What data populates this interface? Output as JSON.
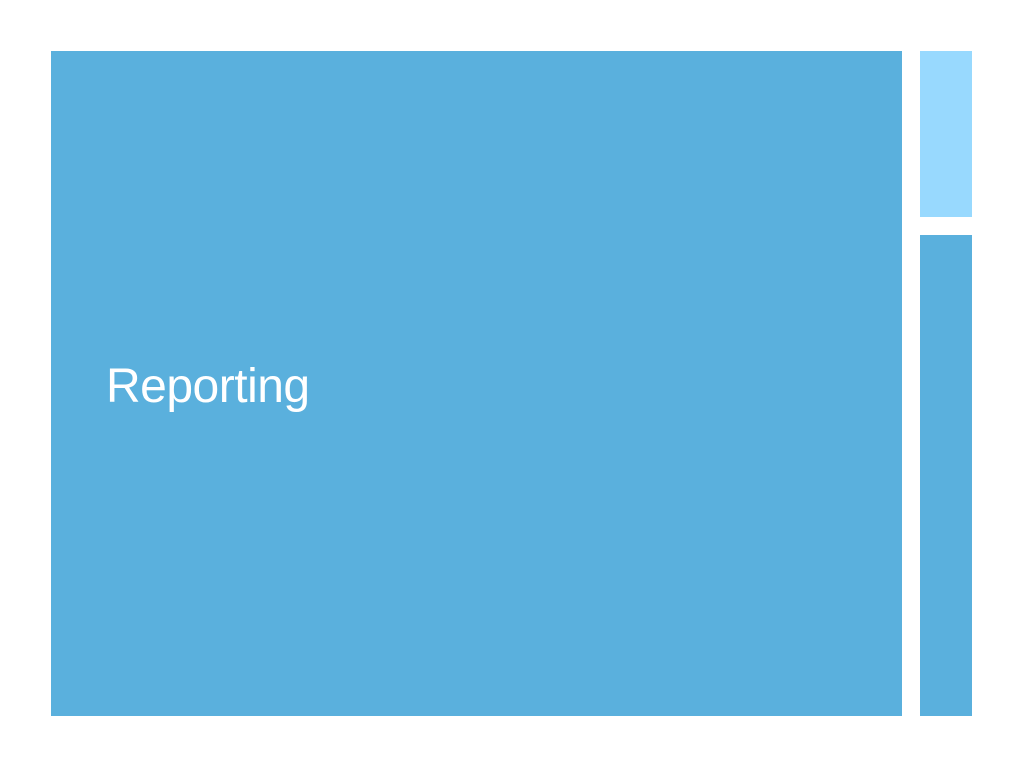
{
  "slide": {
    "title": "Reporting"
  },
  "colors": {
    "background": "#ffffff",
    "main_panel": "#5ab0dd",
    "side_accent_top": "#98d9fe",
    "side_accent_bottom": "#5ab0dd",
    "title_text": "#ffffff"
  }
}
